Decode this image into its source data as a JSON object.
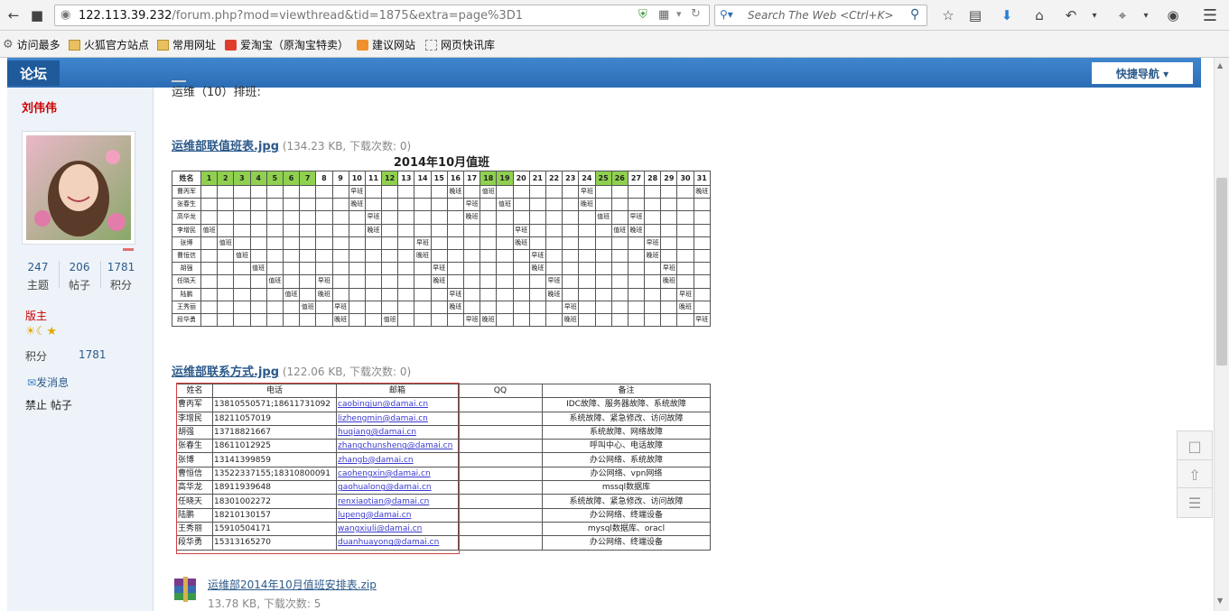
{
  "browser": {
    "url_host": "122.113.39.232",
    "url_path": "/forum.php?mod=viewthread&tid=1875&extra=page%3D1",
    "search_placeholder": "Search The Web <Ctrl+K>"
  },
  "bookmarks": [
    {
      "label": "访问最多"
    },
    {
      "label": "火狐官方站点"
    },
    {
      "label": "常用网址"
    },
    {
      "label": "爱淘宝（原淘宝特卖）"
    },
    {
      "label": "建议网站"
    },
    {
      "label": "网页快讯库"
    }
  ],
  "nav": {
    "brand": "论坛",
    "quick_nav": "快捷导航 ▾"
  },
  "sidebar": {
    "username": "刘伟伟",
    "stats": [
      {
        "value": "247",
        "label": "主题"
      },
      {
        "value": "206",
        "label": "帖子"
      },
      {
        "value": "1781",
        "label": "积分"
      }
    ],
    "role": "版主",
    "points_label": "积分",
    "points_value": "1781",
    "send_message": "发消息",
    "ban_posts": "禁止 帖子"
  },
  "post": {
    "intro": "运维（10）排班:",
    "attachments": [
      {
        "name": "运维部联值班表.jpg",
        "meta": "(134.23 KB, 下载次数: 0)"
      },
      {
        "name": "运维部联系方式.jpg",
        "meta": "(122.06 KB, 下载次数: 0)"
      },
      {
        "name": "运维部2014年10月值班安排表.zip",
        "meta": "13.78 KB, 下载次数: 5"
      }
    ]
  },
  "schedule": {
    "title": "2014年10月值班",
    "name_header": "姓名",
    "days": [
      "1",
      "2",
      "3",
      "4",
      "5",
      "6",
      "7",
      "8",
      "9",
      "10",
      "11",
      "12",
      "13",
      "14",
      "15",
      "16",
      "17",
      "18",
      "19",
      "20",
      "21",
      "22",
      "23",
      "24",
      "25",
      "26",
      "27",
      "28",
      "29",
      "30",
      "31"
    ],
    "holidays": [
      1,
      2,
      3,
      4,
      5,
      6,
      7,
      12,
      18,
      19,
      25,
      26
    ],
    "rows": [
      {
        "name": "曹丙军",
        "cells": {
          "10": "早班",
          "16": "晚班",
          "18": "值班",
          "24": "早班",
          "31": "晚班"
        }
      },
      {
        "name": "张春生",
        "cells": {
          "10": "晚班",
          "17": "早班",
          "19": "值班",
          "24": "晚班"
        }
      },
      {
        "name": "高华龙",
        "cells": {
          "11": "早班",
          "17": "晚班",
          "25": "值班",
          "27": "早班"
        }
      },
      {
        "name": "李增民",
        "cells": {
          "1": "值班",
          "11": "晚班",
          "20": "早班",
          "26": "值班",
          "27": "晚班"
        }
      },
      {
        "name": "张博",
        "cells": {
          "2": "值班",
          "14": "早班",
          "20": "晚班",
          "28": "早班"
        }
      },
      {
        "name": "曹恒信",
        "cells": {
          "3": "值班",
          "14": "晚班",
          "21": "早班",
          "28": "晚班"
        }
      },
      {
        "name": "胡强",
        "cells": {
          "4": "值班",
          "15": "早班",
          "21": "晚班",
          "29": "早班"
        }
      },
      {
        "name": "任晓天",
        "cells": {
          "5": "值班",
          "8": "早班",
          "15": "晚班",
          "22": "早班",
          "29": "晚班"
        }
      },
      {
        "name": "陆鹏",
        "cells": {
          "6": "值班",
          "8": "晚班",
          "16": "早班",
          "22": "晚班",
          "30": "早班"
        }
      },
      {
        "name": "王秀丽",
        "cells": {
          "7": "值班",
          "9": "早班",
          "16": "晚班",
          "23": "早班",
          "30": "晚班"
        }
      },
      {
        "name": "段华勇",
        "cells": {
          "9": "晚班",
          "12": "值班",
          "17": "早班",
          "18": "晚班",
          "23": "晚班",
          "31": "早班"
        }
      }
    ]
  },
  "contacts": {
    "headers": [
      "姓名",
      "电话",
      "邮箱",
      "QQ",
      "备注"
    ],
    "rows": [
      [
        "曹丙军",
        "13810550571;18611731092",
        "caobingjun@damai.cn",
        "",
        "IDC故障、服务器故障、系统故障"
      ],
      [
        "李增民",
        "18211057019",
        "lizhengmin@damai.cn",
        "",
        "系统故障、紧急修改、访问故障"
      ],
      [
        "胡强",
        "13718821667",
        "huqiang@damai.cn",
        "",
        "系统故障、网络故障"
      ],
      [
        "张春生",
        "18611012925",
        "zhangchunsheng@damai.cn",
        "",
        "呼叫中心、电话故障"
      ],
      [
        "张博",
        "13141399859",
        "zhangb@damai.cn",
        "",
        "办公网络、系统故障"
      ],
      [
        "曹恒信",
        "13522337155;18310800091",
        "caohengxin@damai.cn",
        "",
        "办公网络、vpn网络"
      ],
      [
        "高华龙",
        "18911939648",
        "gaohualong@damai.cn",
        "",
        "mssql数据库"
      ],
      [
        "任晓天",
        "18301002272",
        "renxiaotian@damai.cn",
        "",
        "系统故障、紧急修改、访问故障"
      ],
      [
        "陆鹏",
        "18210130157",
        "lupeng@damai.cn",
        "",
        "办公网络、终端设备"
      ],
      [
        "王秀丽",
        "15910504171",
        "wangxiuli@damai.cn",
        "",
        "mysql数据库、oracl"
      ],
      [
        "段华勇",
        "15313165270",
        "duanhuayong@damai.cn",
        "",
        "办公网络、终端设备"
      ]
    ]
  },
  "colors": {
    "holiday": "#8fd14f",
    "nav": "#3277c2",
    "link": "#2c5a8a"
  }
}
